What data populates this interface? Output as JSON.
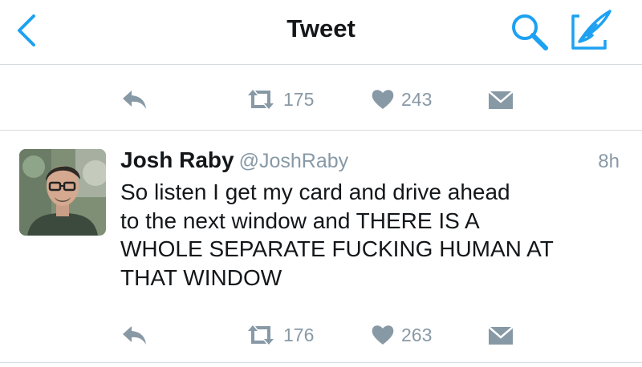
{
  "header": {
    "title": "Tweet",
    "back_icon": "chevron-left-icon",
    "search_icon": "search-icon",
    "compose_icon": "compose-icon"
  },
  "colors": {
    "accent": "#1da1f2",
    "muted": "#8899a6",
    "text": "#14171a",
    "divider": "#d6dbdf"
  },
  "prev_tweet_actions": {
    "retweets": "175",
    "likes": "243"
  },
  "tweet": {
    "name": "Josh Raby",
    "handle": "@JoshRaby",
    "time": "8h",
    "lines": [
      "So listen I get my card and drive ahead",
      "to the next window and THERE IS A",
      "WHOLE SEPARATE FUCKING HUMAN AT",
      "THAT WINDOW"
    ],
    "actions": {
      "retweets": "176",
      "likes": "263"
    }
  }
}
